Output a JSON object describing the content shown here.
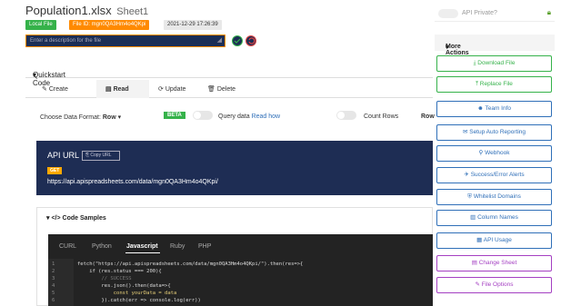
{
  "header": {
    "file_name": "Population1.xlsx",
    "sheet_name": "Sheet1",
    "local_file": "Local File",
    "file_id": "File ID: mgn0QA3Hm4o4QKpi",
    "timestamp": "2021-12-29 17:26:39",
    "description_placeholder": "Enter a description for the file"
  },
  "privacy": {
    "label": "API Private?"
  },
  "quickstart": {
    "title": "Quickstart Code",
    "tabs": [
      {
        "label": "Create"
      },
      {
        "label": "Read"
      },
      {
        "label": "Update"
      },
      {
        "label": "Delete"
      }
    ],
    "format_label": "Choose Data Format:",
    "format_value": "Row",
    "beta": "BETA",
    "query_label": "Query data",
    "read_how": "Read how",
    "count_rows": "Count Rows",
    "row_cut": "Row"
  },
  "api": {
    "label": "API URL",
    "copy": "Copy URL",
    "method": "GET",
    "url": "https://api.apispreadsheets.com/data/mgn0QA3Hm4o4QKpi/"
  },
  "code_samples": {
    "title": "</> Code Samples",
    "tabs": [
      "CURL",
      "Python",
      "Javascript",
      "Ruby",
      "PHP"
    ],
    "line_numbers": [
      "1",
      "2",
      "3",
      "4",
      "5",
      "6"
    ],
    "lines": [
      "fetch(\"https://api.apispreadsheets.com/data/mgn0QA3Hm4o4QKpi/\").then(res=>{",
      "    if (res.status === 200){",
      "        // SUCCESS",
      "        res.json().then(data=>{",
      "            const yourData = data",
      "        }).catch(err => console.log(err))"
    ]
  },
  "actions": {
    "more": "More Actions",
    "items": [
      {
        "label": "Download File",
        "icon": "download-icon",
        "color": "#35b24a"
      },
      {
        "label": "Replace File",
        "icon": "upload-icon",
        "color": "#35b24a"
      },
      {
        "label": "Team Info",
        "icon": "team-icon",
        "color": "#2f6fb8"
      },
      {
        "label": "Setup Auto Reporting",
        "icon": "envelope-icon",
        "color": "#2f6fb8"
      },
      {
        "label": "Webhook",
        "icon": "webhook-icon",
        "color": "#2f6fb8"
      },
      {
        "label": "Success/Error Alerts",
        "icon": "alert-icon",
        "color": "#2f6fb8"
      },
      {
        "label": "Whitelist Domains",
        "icon": "shield-icon",
        "color": "#2f6fb8"
      },
      {
        "label": "Column Names",
        "icon": "columns-icon",
        "color": "#2f6fb8"
      },
      {
        "label": "API Usage",
        "icon": "chart-icon",
        "color": "#2f6fb8"
      },
      {
        "label": "Change Sheet",
        "icon": "sheet-icon",
        "color": "#a43fc2"
      },
      {
        "label": "File Options",
        "icon": "edit-icon",
        "color": "#a43fc2"
      }
    ]
  }
}
